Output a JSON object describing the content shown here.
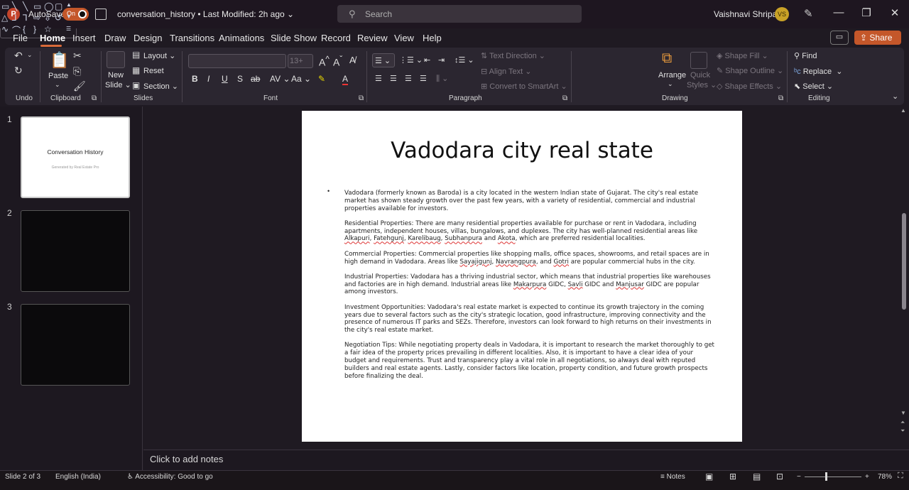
{
  "titlebar": {
    "autosave_label": "AutoSave",
    "autosave_state": "On",
    "document_name": "conversation_history • Last Modified: 2h ago",
    "search_placeholder": "Search",
    "user_name": "Vaishnavi Shripati",
    "user_initials": "VS",
    "share_label": "Share"
  },
  "menu": {
    "tabs": [
      "File",
      "Home",
      "Insert",
      "Draw",
      "Design",
      "Transitions",
      "Animations",
      "Slide Show",
      "Record",
      "Review",
      "View",
      "Help"
    ],
    "active": "Home"
  },
  "ribbon": {
    "undo_group": "Undo",
    "clipboard_group": "Clipboard",
    "paste_label": "Paste",
    "slides_group": "Slides",
    "new_slide_label": "New Slide",
    "layout_label": "Layout",
    "reset_label": "Reset",
    "section_label": "Section",
    "font_group": "Font",
    "font_size": "13+",
    "paragraph_group": "Paragraph",
    "text_direction_label": "Text Direction",
    "align_text_label": "Align Text",
    "convert_smartart_label": "Convert to SmartArt",
    "drawing_group": "Drawing",
    "arrange_label": "Arrange",
    "quick_styles_label": "Quick Styles",
    "shape_fill_label": "Shape Fill",
    "shape_outline_label": "Shape Outline",
    "shape_effects_label": "Shape Effects",
    "editing_group": "Editing",
    "find_label": "Find",
    "replace_label": "Replace",
    "select_label": "Select"
  },
  "thumbnails": {
    "nums": [
      "1",
      "2",
      "3"
    ],
    "slide1_title": "Conversation History",
    "slide1_subtitle": "Generated by Real Estate Pro"
  },
  "slide": {
    "title": "Vadodara city real state",
    "bullet": "•",
    "paragraphs": {
      "p1": "Vadodara (formerly known as Baroda) is a city located in the western Indian state of Gujarat. The city's real estate market has shown steady growth over the past few years, with a variety of residential, commercial and industrial properties available for investors.",
      "p2a": "Residential Properties: There are many residential properties available for purchase or rent in Vadodara, including apartments, independent houses, villas, bungalows, and duplexes. The city has well-planned residential areas like ",
      "p2_w1": "Alkapuri",
      "p2_c1": ", ",
      "p2_w2": "Fatehgunj",
      "p2_c2": ", ",
      "p2_w3": "Karelibaug",
      "p2_c3": ", ",
      "p2_w4": "Subhanpura",
      "p2_c4": " and ",
      "p2_w5": "Akota",
      "p2b": ", which are preferred residential localities.",
      "p3a": "Commercial Properties: Commercial properties like shopping malls, office spaces, showrooms, and retail spaces are in high demand in Vadodara. Areas like ",
      "p3_w1": "Sayajigunj",
      "p3_c1": ", ",
      "p3_w2": "Navrangpura",
      "p3_c2": ", and ",
      "p3_w3": "Gotri",
      "p3b": " are popular commercial hubs in the city.",
      "p4a": "Industrial Properties: Vadodara has a thriving industrial sector, which means that industrial properties like warehouses and factories are in high demand. Industrial areas like ",
      "p4_w1": "Makarpura",
      "p4_c1": " GIDC, ",
      "p4_w2": "Savli",
      "p4_c2": " GIDC and ",
      "p4_w3": "Manjusar",
      "p4b": " GIDC are popular among investors.",
      "p5": "Investment Opportunities: Vadodara's real estate market is expected to continue its growth trajectory in the coming years due to several factors such as the city's strategic location, good infrastructure, improving connectivity and the presence of numerous IT parks and SEZs. Therefore, investors can look forward to high returns on their investments in the city's real estate market.",
      "p6": "Negotiation Tips: While negotiating property deals in Vadodara, it is important to research the market thoroughly to get a fair idea of the property prices prevailing in different localities. Also, it is important to have a clear idea of your budget and requirements. Trust and transparency play a vital role in all negotiations, so always deal with reputed builders and real estate agents. Lastly, consider factors like location, property condition, and future growth prospects before finalizing the deal."
    }
  },
  "notes": {
    "placeholder": "Click to add notes"
  },
  "status": {
    "slide_info": "Slide 2 of 3",
    "language": "English (India)",
    "accessibility": "Accessibility: Good to go",
    "notes_label": "Notes",
    "zoom": "78%"
  },
  "colors": {
    "accent": "#c4572a",
    "background": "#1f1a22",
    "ribbon": "#2b2630"
  }
}
